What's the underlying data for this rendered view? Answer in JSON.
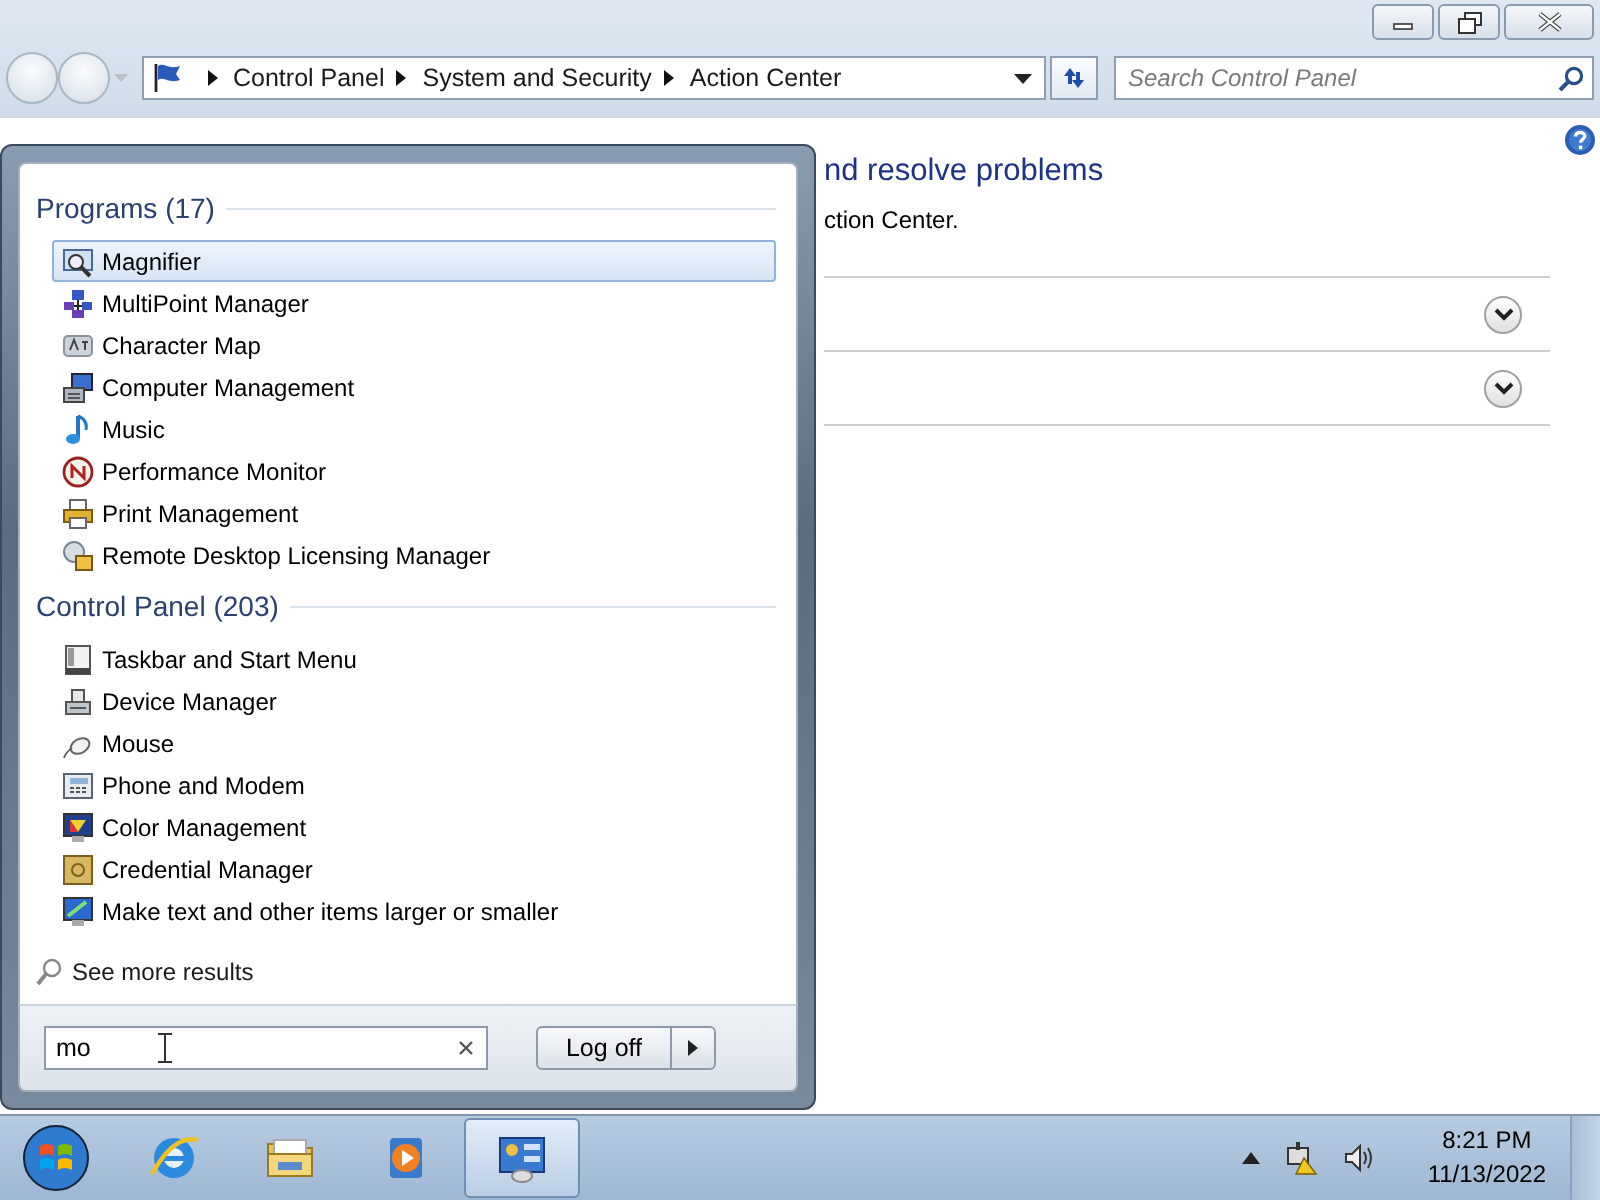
{
  "window": {
    "breadcrumb": [
      "Control Panel",
      "System and Security",
      "Action Center"
    ],
    "search": {
      "placeholder": "Search Control Panel"
    }
  },
  "content": {
    "heading": "nd resolve problems",
    "text": "ction Center.",
    "sections": [
      {
        "expanded": false
      },
      {
        "expanded": false
      }
    ]
  },
  "start_menu": {
    "groups": [
      {
        "title": "Programs (17)",
        "items": [
          {
            "label": "Magnifier",
            "selected": true
          },
          {
            "label": "MultiPoint Manager",
            "selected": false
          },
          {
            "label": "Character Map",
            "selected": false
          },
          {
            "label": "Computer Management",
            "selected": false
          },
          {
            "label": "Music",
            "selected": false
          },
          {
            "label": "Performance Monitor",
            "selected": false
          },
          {
            "label": "Print Management",
            "selected": false
          },
          {
            "label": "Remote Desktop Licensing Manager",
            "selected": false
          }
        ]
      },
      {
        "title": "Control Panel (203)",
        "items": [
          {
            "label": "Taskbar and Start Menu",
            "selected": false
          },
          {
            "label": "Device Manager",
            "selected": false
          },
          {
            "label": "Mouse",
            "selected": false
          },
          {
            "label": "Phone and Modem",
            "selected": false
          },
          {
            "label": "Color Management",
            "selected": false
          },
          {
            "label": "Credential Manager",
            "selected": false
          },
          {
            "label": "Make text and other items larger or smaller",
            "selected": false
          }
        ]
      }
    ],
    "see_more": "See more results",
    "search": {
      "value": "mo"
    },
    "power_button": "Log off"
  },
  "taskbar": {
    "apps": [
      {
        "active": false
      },
      {
        "active": false
      },
      {
        "active": false
      },
      {
        "active": true
      }
    ],
    "time": "8:21 PM",
    "date": "11/13/2022"
  }
}
